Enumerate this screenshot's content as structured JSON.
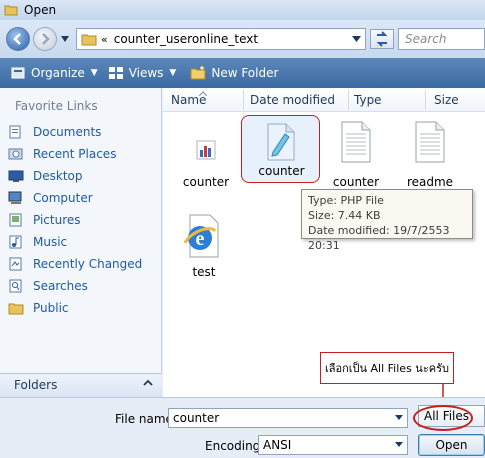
{
  "window": {
    "title": "Open"
  },
  "address": {
    "chevron": "«",
    "path": "counter_useronline_text",
    "search_placeholder": "Search"
  },
  "toolbar": {
    "organize": "Organize",
    "views": "Views",
    "new_folder": "New Folder"
  },
  "navpane": {
    "heading": "Favorite Links",
    "items": [
      {
        "label": "Documents",
        "icon": "documents-icon"
      },
      {
        "label": "Recent Places",
        "icon": "recent-places-icon"
      },
      {
        "label": "Desktop",
        "icon": "desktop-icon"
      },
      {
        "label": "Computer",
        "icon": "computer-icon"
      },
      {
        "label": "Pictures",
        "icon": "pictures-icon"
      },
      {
        "label": "Music",
        "icon": "music-icon"
      },
      {
        "label": "Recently Changed",
        "icon": "recently-changed-icon"
      },
      {
        "label": "Searches",
        "icon": "searches-icon"
      },
      {
        "label": "Public",
        "icon": "public-icon"
      }
    ],
    "folders_label": "Folders"
  },
  "columns": {
    "name": "Name",
    "date_modified": "Date modified",
    "type": "Type",
    "size": "Size"
  },
  "files": [
    {
      "label": "counter",
      "icon": "chart-file-icon"
    },
    {
      "label": "counter",
      "icon": "php-file-icon",
      "selected": true
    },
    {
      "label": "counter",
      "icon": "text-file-icon"
    },
    {
      "label": "readme",
      "icon": "text-file-icon"
    },
    {
      "label": "test",
      "icon": "internet-explorer-icon"
    }
  ],
  "tooltip": {
    "type": "Type: PHP File",
    "size": "Size: 7.44 KB",
    "date": "Date modified: 19/7/2553 20:31"
  },
  "annotation": {
    "text": "เลือกเป็น All Files นะครับ"
  },
  "bottom": {
    "filename_label": "File name:",
    "filename_value": "counter",
    "encoding_label": "Encoding:",
    "encoding_value": "ANSI",
    "filter_value": "All Files",
    "open_label": "Open"
  },
  "colors": {
    "annotation_red": "#c42020",
    "link_blue": "#1f5aa6",
    "toolbar_blue": "#3a6aa4"
  }
}
